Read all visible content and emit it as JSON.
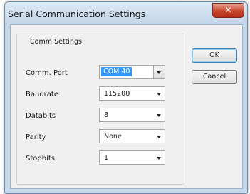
{
  "window": {
    "title": "Serial Communication Settings",
    "close_glyph": "✕"
  },
  "group": {
    "label": "Comm.Settings"
  },
  "fields": [
    {
      "label": "Comm. Port",
      "value": "COM 40"
    },
    {
      "label": "Baudrate",
      "value": "115200"
    },
    {
      "label": "Databits",
      "value": "8"
    },
    {
      "label": "Parity",
      "value": "None"
    },
    {
      "label": "Stopbits",
      "value": "1"
    }
  ],
  "buttons": {
    "ok": "OK",
    "cancel": "Cancel"
  },
  "colors": {
    "selection": "#3399ff",
    "close": "#c7452c",
    "titlebar": "#c5d7ea"
  },
  "icons": {
    "close": "close-icon",
    "dropdown": "chevron-down-icon"
  }
}
